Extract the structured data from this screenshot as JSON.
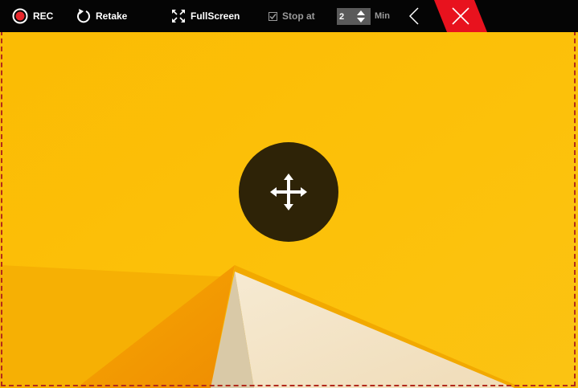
{
  "toolbar": {
    "rec_label": "REC",
    "retake_label": "Retake",
    "fullscreen_label": "FullScreen",
    "stop_at_label": "Stop at",
    "stop_at_checked": true,
    "stop_minutes_value": "2",
    "minutes_unit_label": "Min"
  },
  "icons": {
    "record": "record-icon",
    "retake": "retake-icon",
    "fullscreen": "fullscreen-icon",
    "collapse": "chevron-left-icon",
    "close": "close-icon",
    "move": "move-icon"
  },
  "colors": {
    "toolbar_bg": "#050505",
    "record_red": "#e8262b",
    "close_red": "#e8121e",
    "frame_dash": "#b22a1c",
    "wallpaper_yellow": "#fbbf05",
    "handle": "#2e2307"
  }
}
